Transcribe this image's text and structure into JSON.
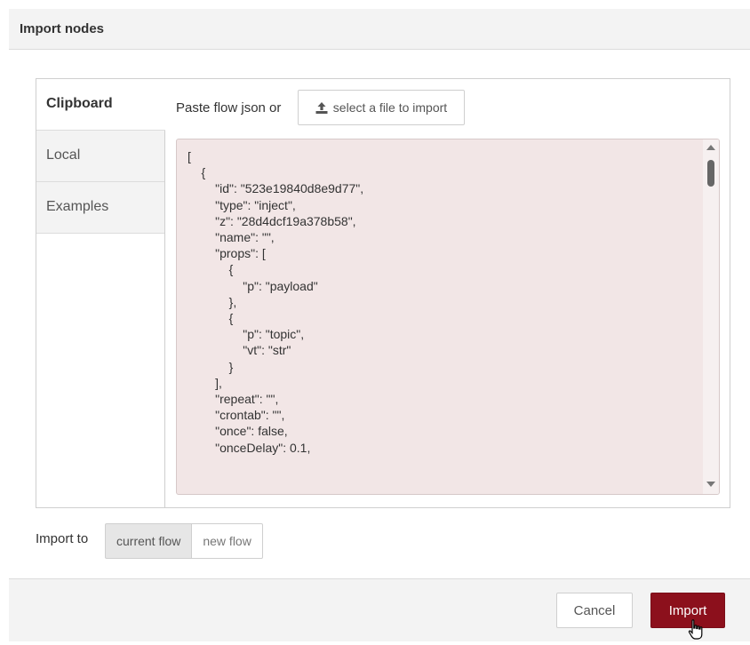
{
  "dialog": {
    "title": "Import nodes"
  },
  "tabs": [
    {
      "label": "Clipboard",
      "active": true
    },
    {
      "label": "Local",
      "active": false
    },
    {
      "label": "Examples",
      "active": false
    }
  ],
  "clipboard": {
    "paste_label": "Paste flow json or",
    "file_button_icon": "upload-icon",
    "file_button_label": "select a file to import",
    "json_text": "[\n    {\n        \"id\": \"523e19840d8e9d77\",\n        \"type\": \"inject\",\n        \"z\": \"28d4dcf19a378b58\",\n        \"name\": \"\",\n        \"props\": [\n            {\n                \"p\": \"payload\"\n            },\n            {\n                \"p\": \"topic\",\n                \"vt\": \"str\"\n            }\n        ],\n        \"repeat\": \"\",\n        \"crontab\": \"\",\n        \"once\": false,\n        \"onceDelay\": 0.1,"
  },
  "import_to": {
    "label": "Import to",
    "options": [
      "current flow",
      "new flow"
    ],
    "selected": "current flow"
  },
  "footer": {
    "cancel_label": "Cancel",
    "import_label": "Import"
  },
  "colors": {
    "accent": "#8c101c",
    "editor_bg": "#f2e6e6"
  }
}
